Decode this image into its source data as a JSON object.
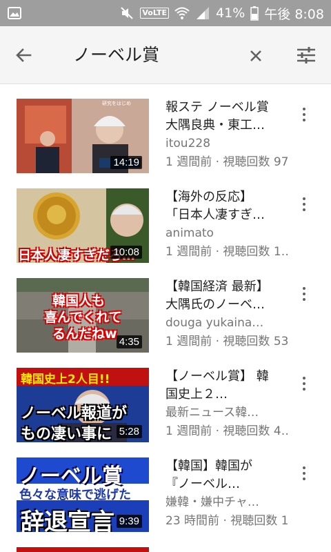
{
  "status_bar": {
    "battery": "41%",
    "time": "午後 8:08",
    "volte": "VoLTE"
  },
  "search": {
    "query": "ノーベル賞"
  },
  "icons": {
    "back": "arrow-back-icon",
    "clear": "close-icon",
    "filter": "tune-icon",
    "more": "more-vert-icon"
  },
  "results": [
    {
      "title": "報ステ ノーベル賞\n大隅良典・東工…",
      "channel": "itou228",
      "stats": "1 週間前 · 視聴回数 97…",
      "duration": "14:19"
    },
    {
      "title": "【海外の反応】\n「日本人凄すぎ…",
      "channel": "animato",
      "stats": "1 週間前 · 視聴回数 1…",
      "duration": "10:08",
      "overlay": "日本人凄すぎだろ…"
    },
    {
      "title": "【韓国経済 最新】\n大隅氏のノーベ…",
      "channel": "douga yukaina…",
      "stats": "1 週間前 · 視聴回数 53…",
      "duration": "4:35",
      "overlay_lines": [
        "韓国人も",
        "喜んでくれて",
        "るんだねw"
      ]
    },
    {
      "title": "【ノーベル賞】 韓\n国史上２…",
      "channel": "最新ニュース韓…",
      "stats": "1 週間前 · 視聴回数 4…",
      "duration": "5:28",
      "overlay_lines": [
        "韓国史上2人目!!",
        "ノーベル報道が",
        "もの凄い事に"
      ]
    },
    {
      "title": "【韓国】韓国が\n『ノーベル…",
      "channel": "嫌韓・嫌中チャ…",
      "stats": "23 時間前 · 視聴回数 1…",
      "duration": "9:39",
      "overlay_lines": [
        "ノーベル賞",
        "色々な意味で逃げた",
        "辞退宣言"
      ]
    }
  ]
}
